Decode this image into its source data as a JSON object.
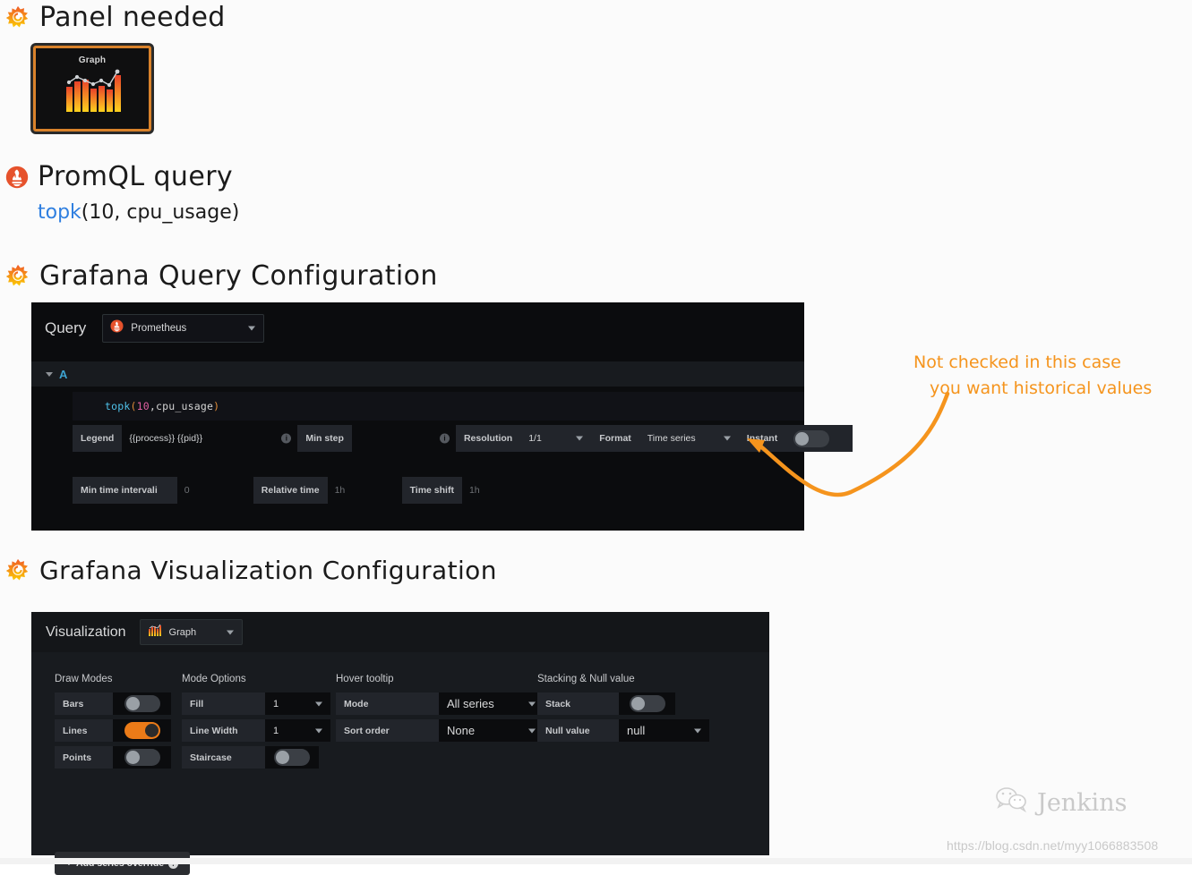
{
  "sections": {
    "panel_needed": {
      "title": "Panel needed",
      "icon": "grafana-logo-icon",
      "thumbnail_label": "Graph"
    },
    "promql": {
      "title": "PromQL query",
      "icon": "prometheus-logo-icon",
      "query_keyword": "topk",
      "query_rest": "(10, cpu_usage)"
    },
    "query_config": {
      "title": "Grafana Query Configuration",
      "icon": "grafana-logo-icon"
    },
    "viz_config": {
      "title": "Grafana Visualization Configuration",
      "icon": "grafana-logo-icon"
    }
  },
  "query_panel": {
    "query_label": "Query",
    "datasource": "Prometheus",
    "datasource_icon": "prometheus-logo-icon",
    "ref_id": "A",
    "expr": {
      "fn": "topk",
      "open_paren": "(",
      "number": "10",
      "args": ",cpu_usage",
      "close_paren": ")"
    },
    "options": [
      {
        "label": "Legend",
        "value": "{{process}} {{pid}}",
        "type": "input",
        "hint": "i"
      },
      {
        "label": "Min step",
        "value": "",
        "type": "input",
        "hint": "i"
      },
      {
        "label": "Resolution",
        "value": "1/1",
        "type": "select"
      },
      {
        "label": "Format",
        "value": "Time series",
        "type": "select"
      },
      {
        "label": "Instant",
        "value": "off",
        "type": "toggle"
      }
    ],
    "bottom_options": [
      {
        "label": "Min time interval",
        "value": "0",
        "type": "input",
        "hint": "i"
      },
      {
        "label": "Relative time",
        "value": "1h",
        "type": "input"
      },
      {
        "label": "Time shift",
        "value": "1h",
        "type": "input"
      }
    ]
  },
  "viz_panel": {
    "viz_label": "Visualization",
    "viz_type": "Graph",
    "viz_icon": "graph-panel-icon",
    "columns": [
      {
        "title": "Draw Modes",
        "rows": [
          {
            "label": "Bars",
            "type": "toggle",
            "value": "off"
          },
          {
            "label": "Lines",
            "type": "toggle",
            "value": "on"
          },
          {
            "label": "Points",
            "type": "toggle",
            "value": "off"
          }
        ]
      },
      {
        "title": "Mode Options",
        "rows": [
          {
            "label": "Fill",
            "type": "select",
            "value": "1"
          },
          {
            "label": "Line Width",
            "type": "select",
            "value": "1"
          },
          {
            "label": "Staircase",
            "type": "toggle",
            "value": "off"
          }
        ]
      },
      {
        "title": "Hover tooltip",
        "rows": [
          {
            "label": "Mode",
            "type": "select",
            "value": "All series"
          },
          {
            "label": "Sort order",
            "type": "select",
            "value": "None"
          }
        ]
      },
      {
        "title": "Stacking & Null value",
        "rows": [
          {
            "label": "Stack",
            "type": "toggle",
            "value": "off"
          },
          {
            "label": "Null value",
            "type": "select",
            "value": "null"
          }
        ]
      }
    ],
    "add_override_label": "Add series override"
  },
  "annotation": {
    "line1": "Not checked in this case",
    "line2": "you want historical values",
    "color": "#f5941d"
  },
  "watermark": {
    "brand": "Jenkins",
    "icon": "wechat-icon",
    "url": "https://blog.csdn.net/myy1066883508"
  },
  "colors": {
    "accent_orange": "#eb7b18",
    "panel_bg": "#181b1f",
    "panel_dark": "#0b0c0e",
    "text": "#d8d9da",
    "link_blue": "#2f7fe0"
  }
}
